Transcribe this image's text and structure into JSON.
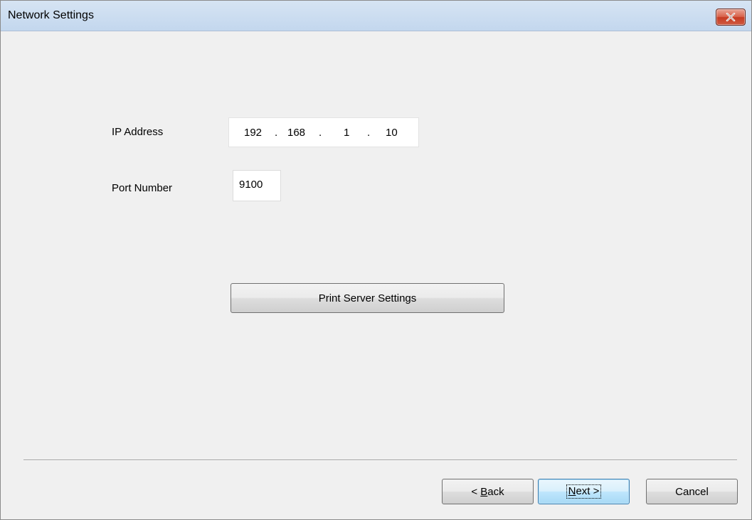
{
  "window": {
    "title": "Network Settings"
  },
  "form": {
    "ip_label": "IP Address",
    "ip_octets": [
      "192",
      "168",
      "1",
      "10"
    ],
    "ip_separator": ".",
    "port_label": "Port Number",
    "port_value": "9100",
    "print_server_button": "Print Server Settings"
  },
  "footer": {
    "back_prefix": "< ",
    "back_mnemonic": "B",
    "back_rest": "ack",
    "next_mnemonic": "N",
    "next_rest": "ext >",
    "cancel_label": "Cancel"
  }
}
